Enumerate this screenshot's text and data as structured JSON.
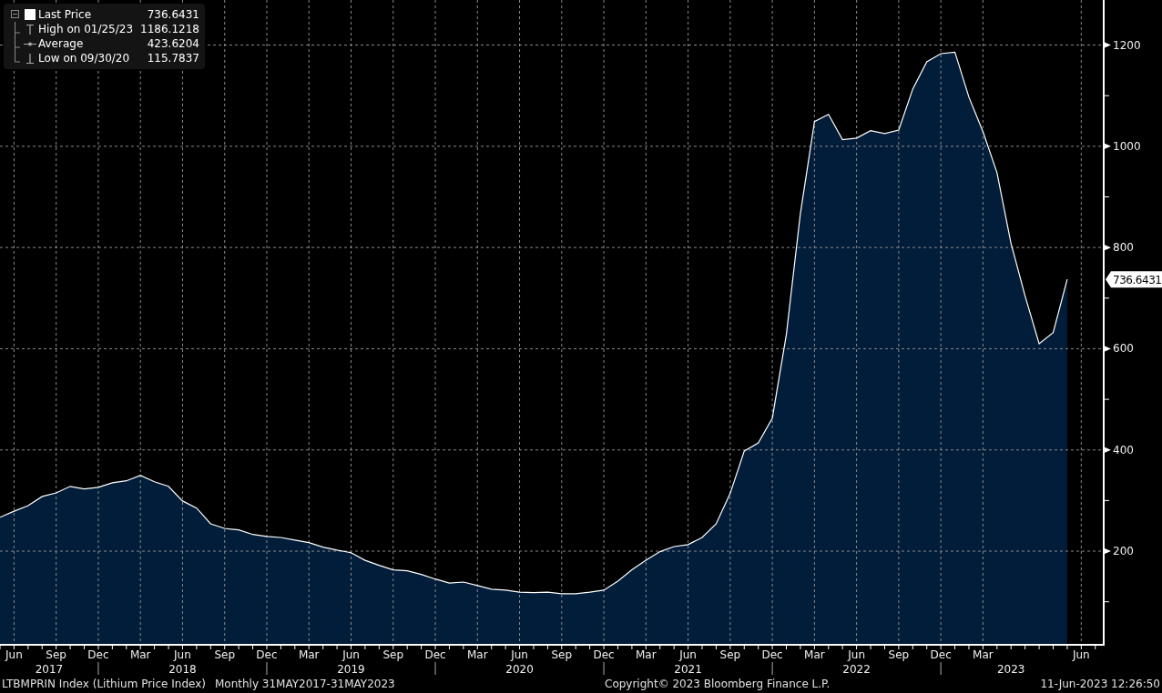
{
  "legend": {
    "items": [
      {
        "kind": "last",
        "label": "Last Price",
        "value": "736.6431"
      },
      {
        "kind": "high",
        "label": "High on 01/25/23",
        "value": "1186.1218"
      },
      {
        "kind": "average",
        "label": "Average",
        "value": "423.6204"
      },
      {
        "kind": "low",
        "label": "Low on 09/30/20",
        "value": "115.7837"
      }
    ]
  },
  "chart": {
    "last_price_tag": "736.6431",
    "year_labels": [
      "2017",
      "2018",
      "2019",
      "2020",
      "2021",
      "2022",
      "2023"
    ],
    "chart_data": {
      "type": "area",
      "grid": true,
      "ylim": [
        15,
        1289
      ],
      "yticks": [
        200,
        400,
        600,
        800,
        1000,
        1200
      ],
      "categories": [
        null,
        "Jun",
        null,
        null,
        "Sep",
        null,
        null,
        "Dec",
        null,
        null,
        "Mar",
        null,
        null,
        "Jun",
        null,
        null,
        "Sep",
        null,
        null,
        "Dec",
        null,
        null,
        "Mar",
        null,
        null,
        "Jun",
        null,
        null,
        "Sep",
        null,
        null,
        "Dec",
        null,
        null,
        "Mar",
        null,
        null,
        "Jun",
        null,
        null,
        "Sep",
        null,
        null,
        "Dec",
        null,
        null,
        "Mar",
        null,
        null,
        "Jun",
        null,
        null,
        "Sep",
        null,
        null,
        "Dec",
        null,
        null,
        "Mar",
        null,
        null,
        "Jun",
        null,
        null,
        "Sep",
        null,
        null,
        "Dec",
        null,
        null,
        "Mar",
        null,
        null,
        null,
        null,
        null,
        null,
        "Jun"
      ],
      "series": [
        {
          "color": "#ffffff",
          "values": [
            267,
            279,
            290,
            308,
            315,
            328,
            323,
            326,
            335,
            339,
            350,
            337,
            328,
            299,
            285,
            254,
            245,
            242,
            233,
            229,
            227,
            222,
            217,
            208,
            202,
            197,
            182,
            172,
            163,
            161,
            154,
            145,
            137,
            139,
            132,
            125,
            123,
            119,
            118,
            119,
            116,
            116,
            119,
            123,
            141,
            163,
            182,
            199,
            209,
            213,
            227,
            254,
            314,
            398,
            414,
            463,
            628,
            867,
            1049,
            1063,
            1013,
            1016,
            1031,
            1025,
            1032,
            1113,
            1167,
            1183,
            1186,
            1097,
            1029,
            948,
            808,
            704,
            610,
            632,
            737,
            null
          ]
        }
      ]
    }
  },
  "footer": {
    "index_name": "LTBMPRIN Index (Lithium Price Index)",
    "range": "Monthly 31MAY2017-31MAY2023",
    "copyright": "Copyright© 2023 Bloomberg Finance L.P.",
    "timestamp": "11-Jun-2023 12:26:50"
  }
}
